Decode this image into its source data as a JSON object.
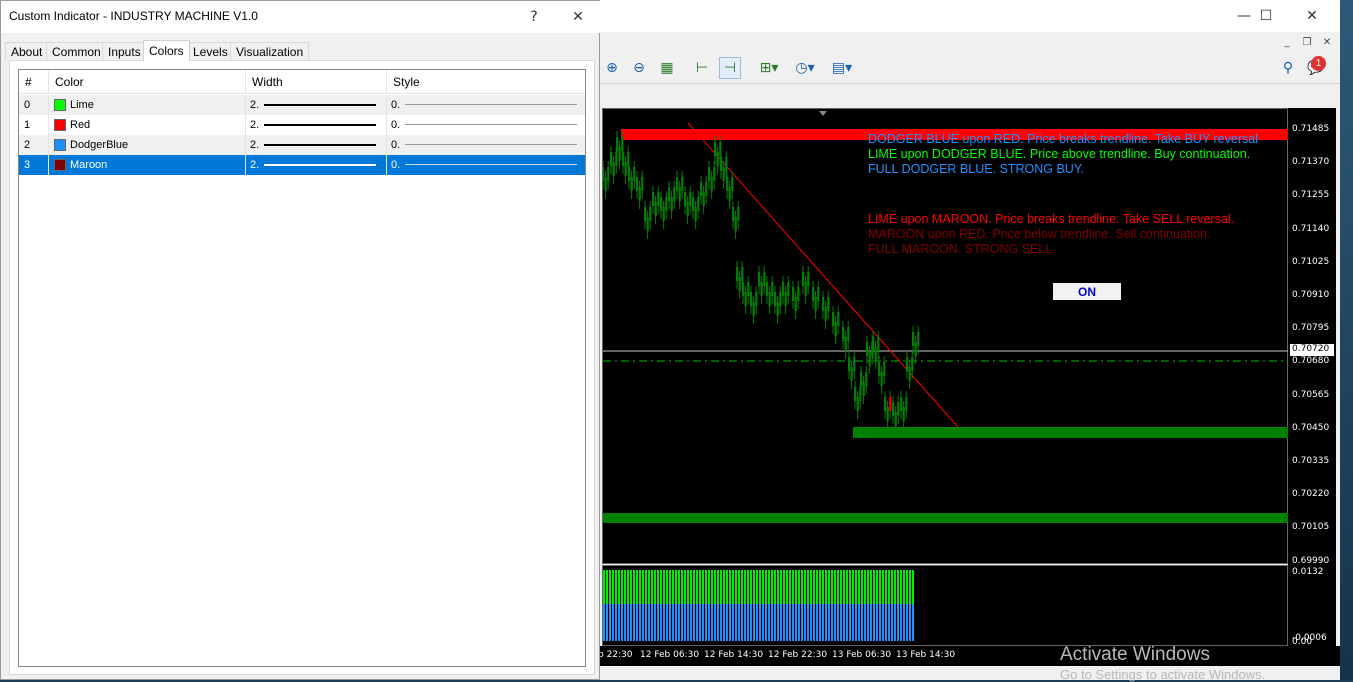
{
  "dialog": {
    "title": "Custom Indicator - INDUSTRY MACHINE V1.0",
    "help_label": "?",
    "close_label": "✕",
    "tabs": [
      "About",
      "Common",
      "Inputs",
      "Colors",
      "Levels",
      "Visualization"
    ],
    "active_tab": "Colors",
    "columns": [
      "#",
      "Color",
      "Width",
      "Style"
    ],
    "rows": [
      {
        "index": "0",
        "color_name": "Lime",
        "swatch": "#00ff00",
        "width": "2.",
        "style": "0."
      },
      {
        "index": "1",
        "color_name": "Red",
        "swatch": "#ff0000",
        "width": "2.",
        "style": "0."
      },
      {
        "index": "2",
        "color_name": "DodgerBlue",
        "swatch": "#1e90ff",
        "width": "2.",
        "style": "0."
      },
      {
        "index": "3",
        "color_name": "Maroon",
        "swatch": "#800000",
        "width": "2.",
        "style": "0."
      }
    ],
    "selected_row": 3
  },
  "terminal": {
    "minimize_label": "—",
    "maximize_label": "☐",
    "close_label": "✕",
    "notification_count": "1",
    "toolbar_icons": [
      "zoom-in-icon",
      "zoom-out-icon",
      "tile-windows-icon",
      "chart-shift-icon",
      "auto-scroll-icon",
      "indicators-icon",
      "periods-icon",
      "templates-icon"
    ],
    "search_icon": "search-icon"
  },
  "chart": {
    "annotations": [
      {
        "text": "DODGER BLUE upon RED. Price breaks trendline. Take BUY reversal",
        "color": "#1e90ff"
      },
      {
        "text": "LIME upon DODGER BLUE. Price above trendline. Buy continuation.",
        "color": "#00ff00"
      },
      {
        "text": "FULL DODGER BLUE. STRONG BUY.",
        "color": "#1e90ff"
      },
      {
        "text": "LIME upon MAROON. Price breaks trendline. Take SELL reversal.",
        "color": "#ff0000"
      },
      {
        "text": "MAROON upon RED. Price below trendline. Sell continuation.",
        "color": "#800000"
      },
      {
        "text": "FULL MAROON. STRONG SELL.",
        "color": "#800000"
      }
    ],
    "on_button": "ON",
    "price_ticks": [
      "0.71485",
      "0.71370",
      "0.71255",
      "0.71140",
      "0.71025",
      "0.70910",
      "0.70795",
      "0.70680",
      "0.70565",
      "0.70450",
      "0.70335",
      "0.70220",
      "0.70105",
      "0.69990"
    ],
    "current_price": "0.70720",
    "sub_ticks": [
      "0.0132",
      "-0.0006",
      "0.00"
    ],
    "time_ticks": [
      "b 22:30",
      "12 Feb 06:30",
      "12 Feb 14:30",
      "12 Feb 22:30",
      "13 Feb 06:30",
      "13 Feb 14:30"
    ]
  },
  "os": {
    "activate_title": "Activate Windows",
    "activate_sub": "Go to Settings to activate Windows."
  }
}
